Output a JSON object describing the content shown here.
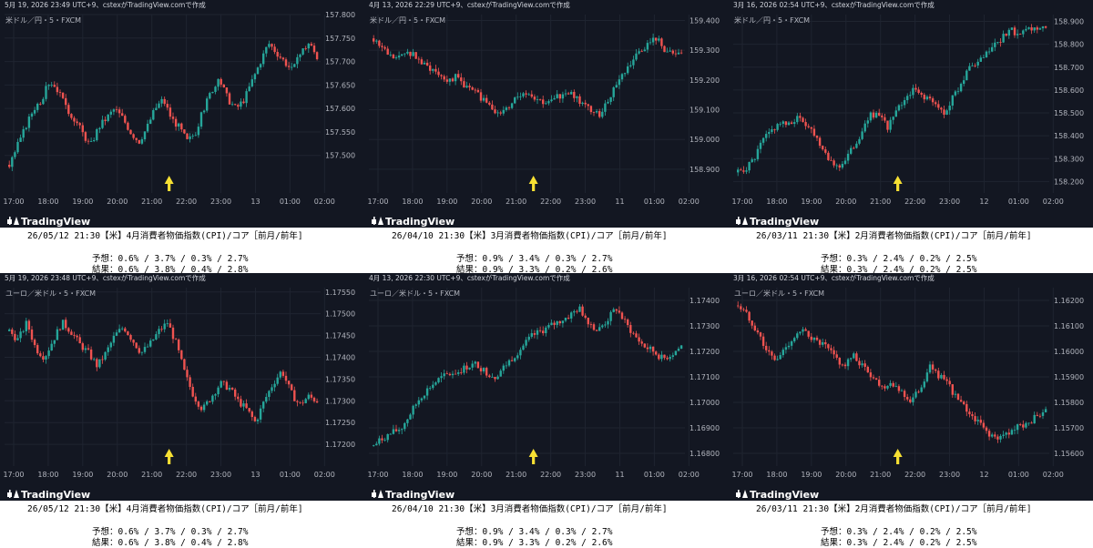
{
  "colors": {
    "up": "#26a69a",
    "down": "#ef5350",
    "bg": "#131722",
    "grid": "#1f2430",
    "text": "#b2b5be",
    "arrow": "#f7e033"
  },
  "icons": {
    "arrow": "up-arrow-icon",
    "logo": "tradingview-logo"
  },
  "brand": "TradingView",
  "panels": [
    {
      "header": "5月 19, 2026 23:49 UTC+9、cstexがTradingView.comで作成",
      "symbol": "米ドル／円・5・FXCM",
      "caption_title": "26/05/12  21:30【米】4月消費者物価指数(CPI)/コア［前月/前年]",
      "forecast": "予想：0.6% / 3.7% / 0.3% / 2.7%",
      "result": "結果：0.6% / 3.8% / 0.4% / 2.8%",
      "chart_data": {
        "type": "candlestick",
        "ylim": [
          157.42,
          157.8
        ],
        "yticks": [
          "157.800",
          "157.750",
          "157.700",
          "157.650",
          "157.600",
          "157.550",
          "157.500"
        ],
        "xticks": [
          "17:00",
          "18:00",
          "19:00",
          "20:00",
          "21:00",
          "22:00",
          "23:00",
          "13",
          "01:00",
          "02:00"
        ],
        "event_x": "21:30",
        "path": [
          157.48,
          157.52,
          157.56,
          157.6,
          157.62,
          157.66,
          157.64,
          157.6,
          157.58,
          157.55,
          157.52,
          157.56,
          157.58,
          157.6,
          157.58,
          157.55,
          157.53,
          157.56,
          157.6,
          157.62,
          157.58,
          157.56,
          157.53,
          157.55,
          157.6,
          157.64,
          157.66,
          157.62,
          157.6,
          157.62,
          157.66,
          157.7,
          157.74,
          157.72,
          157.7,
          157.68,
          157.72,
          157.74,
          157.71
        ]
      }
    },
    {
      "header": "4月 13, 2026 22:29 UTC+9、cstexがTradingView.comで作成",
      "symbol": "米ドル／円・5・FXCM",
      "caption_title": "26/04/10  21:30【米】3月消費者物価指数(CPI)/コア［前月/前年]",
      "forecast": "予想：0.9% / 3.4% / 0.3% / 2.7%",
      "result": "結果：0.9% / 3.3% / 0.2% / 2.6%",
      "chart_data": {
        "type": "candlestick",
        "ylim": [
          158.82,
          159.42
        ],
        "yticks": [
          "159.400",
          "159.300",
          "159.200",
          "159.100",
          "159.000",
          "158.900"
        ],
        "xticks": [
          "17:00",
          "18:00",
          "19:00",
          "20:00",
          "21:00",
          "22:00",
          "23:00",
          "11",
          "01:00",
          "02:00"
        ],
        "event_x": "21:30",
        "path": [
          159.34,
          159.31,
          159.28,
          159.27,
          159.3,
          159.28,
          159.25,
          159.24,
          159.22,
          159.2,
          159.21,
          159.18,
          159.16,
          159.14,
          159.12,
          159.08,
          159.1,
          159.14,
          159.16,
          159.15,
          159.13,
          159.12,
          159.14,
          159.16,
          159.15,
          159.12,
          159.1,
          159.08,
          159.12,
          159.18,
          159.22,
          159.26,
          159.3,
          159.32,
          159.34,
          159.3,
          159.28,
          159.29
        ]
      }
    },
    {
      "header": "3月 16, 2026 02:54 UTC+9、cstexがTradingView.comで作成",
      "symbol": "米ドル／円・5・FXCM",
      "caption_title": "26/03/11  21:30【米】2月消費者物価指数(CPI)/コア［前月/前年]",
      "forecast": "予想：0.3% / 2.4% / 0.2% / 2.5%",
      "result": "結果：0.3% / 2.4% / 0.2% / 2.5%",
      "chart_data": {
        "type": "candlestick",
        "ylim": [
          158.15,
          158.93
        ],
        "yticks": [
          "158.900",
          "158.800",
          "158.700",
          "158.600",
          "158.500",
          "158.400",
          "158.300",
          "158.200"
        ],
        "xticks": [
          "17:00",
          "18:00",
          "19:00",
          "20:00",
          "21:00",
          "22:00",
          "23:00",
          "12",
          "01:00",
          "02:00"
        ],
        "event_x": "21:30",
        "path": [
          158.24,
          158.26,
          158.3,
          158.38,
          158.42,
          158.46,
          158.44,
          158.48,
          158.46,
          158.42,
          158.36,
          158.3,
          158.26,
          158.3,
          158.36,
          158.42,
          158.5,
          158.48,
          158.44,
          158.5,
          158.56,
          158.6,
          158.58,
          158.56,
          158.52,
          158.5,
          158.58,
          158.64,
          158.7,
          158.72,
          158.76,
          158.8,
          158.84,
          158.86,
          158.84,
          158.86,
          158.87,
          158.86
        ]
      }
    },
    {
      "header": "5月 19, 2026 23:48 UTC+9、cstexがTradingView.comで作成",
      "symbol": "ユーロ／米ドル・5・FXCM",
      "caption_title": "26/05/12  21:30【米】4月消費者物価指数(CPI)/コア［前月/前年]",
      "forecast": "予想：0.6% / 3.7% / 0.3% / 2.7%",
      "result": "結果：0.6% / 3.8% / 0.4% / 2.8%",
      "chart_data": {
        "type": "candlestick",
        "ylim": [
          1.1715,
          1.1756
        ],
        "yticks": [
          "1.17550",
          "1.17500",
          "1.17450",
          "1.17400",
          "1.17350",
          "1.17300",
          "1.17250",
          "1.17200"
        ],
        "xticks": [
          "17:00",
          "18:00",
          "19:00",
          "20:00",
          "21:00",
          "22:00",
          "23:00",
          "13",
          "01:00",
          "02:00"
        ],
        "event_x": "21:30",
        "path": [
          1.1746,
          1.1744,
          1.1748,
          1.1742,
          1.174,
          1.1744,
          1.1748,
          1.1746,
          1.1743,
          1.1741,
          1.1738,
          1.1741,
          1.1745,
          1.1747,
          1.1744,
          1.1741,
          1.1743,
          1.1746,
          1.1748,
          1.1743,
          1.1736,
          1.1731,
          1.1728,
          1.1731,
          1.1734,
          1.1733,
          1.173,
          1.1728,
          1.1725,
          1.173,
          1.1734,
          1.1737,
          1.1732,
          1.1729,
          1.1731,
          1.173
        ]
      }
    },
    {
      "header": "4月 13, 2026 22:30 UTC+9、cstexがTradingView.comで作成",
      "symbol": "ユーロ／米ドル・5・FXCM",
      "caption_title": "26/04/10  21:30【米】3月消費者物価指数(CPI)/コア［前月/前年]",
      "forecast": "予想：0.9% / 3.4% / 0.3% / 2.7%",
      "result": "結果：0.9% / 3.3% / 0.2% / 2.6%",
      "chart_data": {
        "type": "candlestick",
        "ylim": [
          1.1675,
          1.1745
        ],
        "yticks": [
          "1.17400",
          "1.17300",
          "1.17200",
          "1.17100",
          "1.17000",
          "1.16900",
          "1.16800"
        ],
        "xticks": [
          "17:00",
          "18:00",
          "19:00",
          "20:00",
          "21:00",
          "22:00",
          "23:00",
          "11",
          "01:00",
          "02:00"
        ],
        "event_x": "21:30",
        "path": [
          1.1683,
          1.1686,
          1.1688,
          1.169,
          1.1696,
          1.1702,
          1.1706,
          1.1709,
          1.1711,
          1.1712,
          1.1714,
          1.1715,
          1.1712,
          1.171,
          1.1714,
          1.1718,
          1.1722,
          1.1726,
          1.1728,
          1.173,
          1.1732,
          1.1734,
          1.1737,
          1.1732,
          1.1728,
          1.1732,
          1.1737,
          1.1731,
          1.1726,
          1.1722,
          1.172,
          1.1717,
          1.1719,
          1.1722
        ]
      }
    },
    {
      "header": "3月 16, 2026 02:54 UTC+9、cstexがTradingView.comで作成",
      "symbol": "ユーロ／米ドル・5・FXCM",
      "caption_title": "26/03/11  21:30【米】2月消費者物価指数(CPI)/コア［前月/前年]",
      "forecast": "予想：0.3% / 2.4% / 0.2% / 2.5%",
      "result": "結果：0.3% / 2.4% / 0.2% / 2.5%",
      "chart_data": {
        "type": "candlestick",
        "ylim": [
          1.1555,
          1.1625
        ],
        "yticks": [
          "1.16200",
          "1.16100",
          "1.16000",
          "1.15900",
          "1.15800",
          "1.15700",
          "1.15600"
        ],
        "xticks": [
          "17:00",
          "18:00",
          "19:00",
          "20:00",
          "21:00",
          "22:00",
          "23:00",
          "12",
          "01:00",
          "02:00"
        ],
        "event_x": "21:30",
        "path": [
          1.1618,
          1.1614,
          1.1608,
          1.16,
          1.1596,
          1.1602,
          1.1606,
          1.1608,
          1.1604,
          1.1602,
          1.1598,
          1.1594,
          1.1598,
          1.1594,
          1.159,
          1.1586,
          1.1588,
          1.1584,
          1.158,
          1.1586,
          1.1594,
          1.159,
          1.1586,
          1.158,
          1.1576,
          1.1572,
          1.1568,
          1.1565,
          1.1568,
          1.157,
          1.1572,
          1.1574,
          1.1576
        ]
      }
    }
  ]
}
